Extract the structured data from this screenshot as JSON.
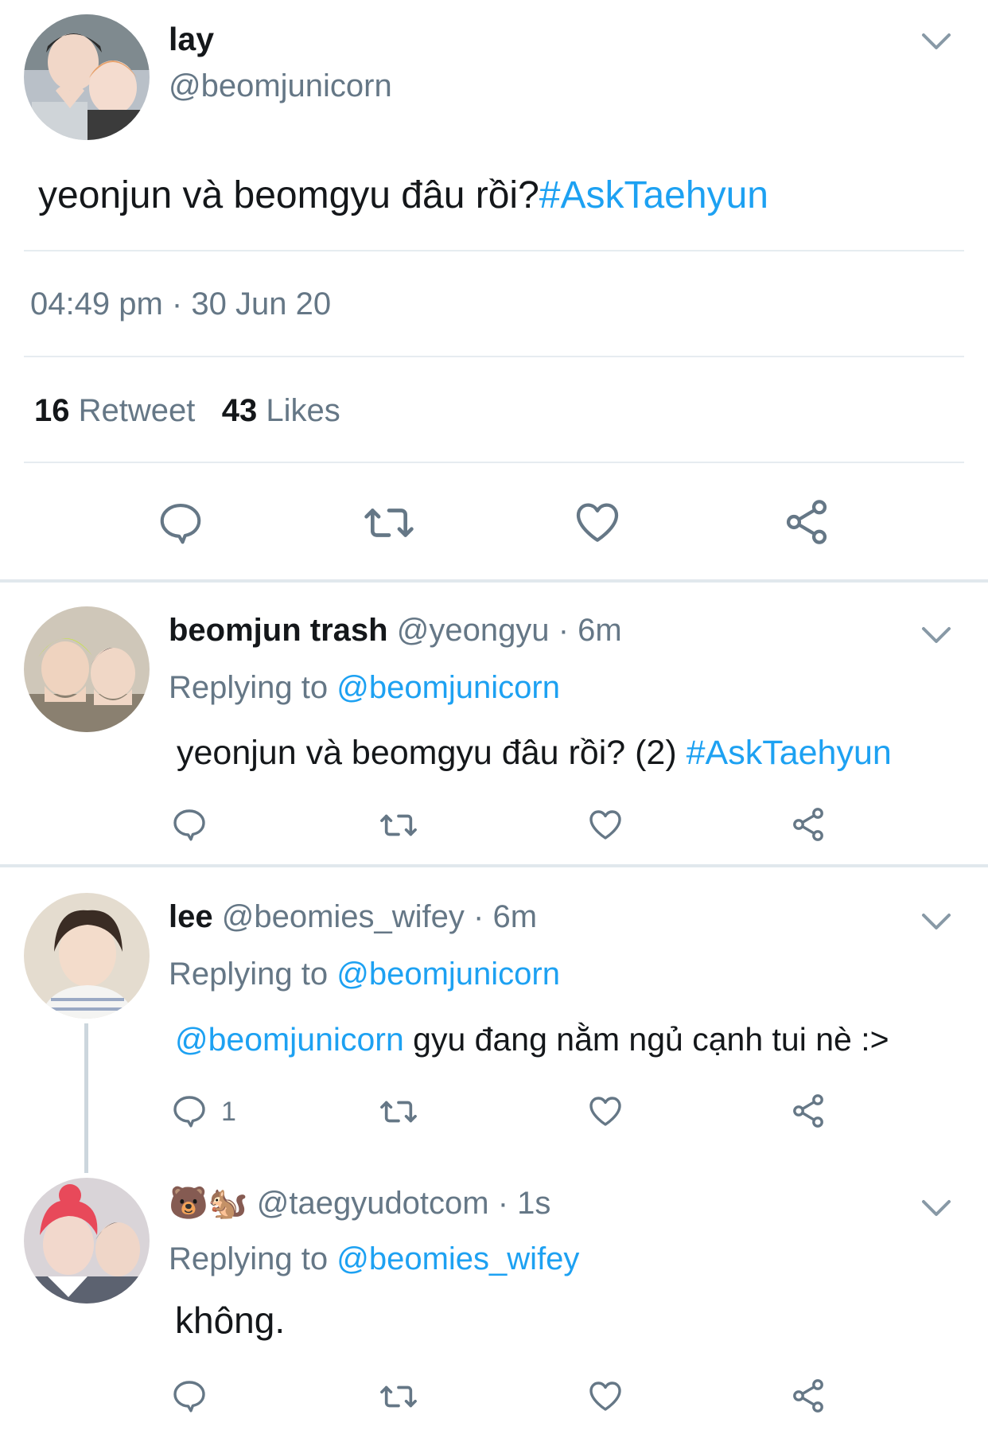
{
  "main_tweet": {
    "name": "lay",
    "handle": "@beomjunicorn",
    "text": "yeonjun và beomgyu đâu rồi?",
    "hashtag": "#AskTaehyun",
    "time": "04:49 pm",
    "dot": "·",
    "date": "30 Jun 20",
    "retweets_count": "16",
    "retweets_label": "Retweet",
    "likes_count": "43",
    "likes_label": "Likes"
  },
  "replies": [
    {
      "name": "beomjun trash",
      "handle": "@yeongyu",
      "time": "· 6m",
      "replying_label": "Replying to",
      "replying_handle": "@beomjunicorn",
      "text": "yeonjun và beomgyu đâu rồi? (2)",
      "hashtag": "#AskTaehyun",
      "reply_count": ""
    },
    {
      "name": "lee",
      "handle": "@beomies_wifey",
      "time": "· 6m",
      "replying_label": "Replying to",
      "replying_handle": "@beomjunicorn",
      "mention": "@beomjunicorn",
      "text": "gyu đang nằm ngủ cạnh tui nè :>",
      "reply_count": "1"
    },
    {
      "name": "🐻🐿️",
      "handle": "@taegyudotcom",
      "time": "· 1s",
      "replying_label": "Replying to",
      "replying_handle": "@beomies_wifey",
      "text": "không.",
      "reply_count": ""
    }
  ],
  "colors": {
    "accent": "#1da1f2",
    "secondary_text": "#657786",
    "icon": "#657786",
    "divider": "#e6ecf0"
  },
  "icons": [
    "chevron-down-icon",
    "reply-icon",
    "retweet-icon",
    "like-icon",
    "share-icon"
  ]
}
